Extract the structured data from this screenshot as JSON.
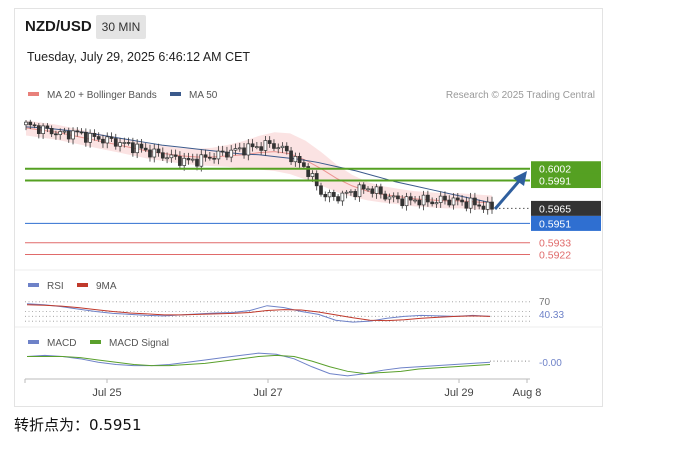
{
  "header": {
    "pair": "NZD/USD",
    "timeframe": "30 MIN",
    "datetime": "Tuesday, July 29, 2025 6:46:12 AM CET"
  },
  "legend_main": {
    "ma20": "MA 20 + Bollinger Bands",
    "ma50": "MA 50",
    "credit": "Research © 2025 Trading Central"
  },
  "legend_rsi": {
    "rsi": "RSI",
    "ma9": "9MA"
  },
  "legend_macd": {
    "macd": "MACD",
    "signal": "MACD Signal"
  },
  "colors": {
    "ma20": "#e8807a",
    "ma50": "#3b5a8c",
    "band_fill": "#fbe0e0",
    "green_level": "#55a022",
    "blue_level": "#2f6fd1",
    "red_level": "#e06a6a",
    "current": "#333333",
    "rsi": "#6e82c8",
    "rsi_ma": "#c0392b",
    "macd": "#6e82c8",
    "macd_signal": "#5aa02c",
    "arrow": "#2f5f9e"
  },
  "footer_note": "转折点为：0.5951",
  "chart_data": [
    {
      "type": "candlestick",
      "title": "NZD/USD 30 MIN",
      "x": [
        "Jul 25",
        "Jul 27",
        "Jul 29",
        "Aug 8"
      ],
      "price_levels": [
        {
          "value": 0.6002,
          "label": "0.6002",
          "color": "#55a022",
          "kind": "resistance"
        },
        {
          "value": 0.5991,
          "label": "0.5991",
          "color": "#55a022",
          "kind": "resistance"
        },
        {
          "value": 0.5965,
          "label": "0.5965",
          "color": "#333333",
          "kind": "current"
        },
        {
          "value": 0.5951,
          "label": "0.5951",
          "color": "#2f6fd1",
          "kind": "pivot"
        },
        {
          "value": 0.5933,
          "label": "0.5933",
          "color": "#e06a6a",
          "kind": "support"
        },
        {
          "value": 0.5922,
          "label": "0.5922",
          "color": "#e06a6a",
          "kind": "support"
        }
      ],
      "ylim": [
        0.5915,
        0.6054
      ],
      "close_series": [
        0.6043,
        0.604,
        0.6037,
        0.6034,
        0.6036,
        0.6032,
        0.603,
        0.6028,
        0.6025,
        0.6022,
        0.6018,
        0.6015,
        0.6012,
        0.6009,
        0.601,
        0.6013,
        0.6016,
        0.6019,
        0.6021,
        0.6023,
        0.6025,
        0.602,
        0.601,
        0.6,
        0.598,
        0.5975,
        0.5978,
        0.5982,
        0.5984,
        0.5978,
        0.5974,
        0.5972,
        0.5973,
        0.5971,
        0.5973,
        0.5972,
        0.597,
        0.5968,
        0.5965
      ],
      "ma20": [
        0.604,
        0.6038,
        0.6036,
        0.6033,
        0.603,
        0.6027,
        0.6024,
        0.6021,
        0.6018,
        0.6016,
        0.6014,
        0.6013,
        0.6013,
        0.6014,
        0.6015,
        0.6017,
        0.6018,
        0.6016,
        0.601,
        0.6002,
        0.5993,
        0.5986,
        0.5981,
        0.5978,
        0.5976,
        0.5974,
        0.5973,
        0.5972,
        0.5972,
        0.5971,
        0.597
      ],
      "ma50": [
        0.6041,
        0.604,
        0.6038,
        0.6036,
        0.6033,
        0.603,
        0.6027,
        0.6024,
        0.6022,
        0.602,
        0.6018,
        0.6016,
        0.6015,
        0.6013,
        0.6011,
        0.6008,
        0.6004,
        0.6,
        0.5995,
        0.599,
        0.5986,
        0.5982,
        0.5978,
        0.5974,
        0.597
      ],
      "forecast_arrow": {
        "from": 0.5965,
        "to": 0.5997
      }
    },
    {
      "type": "line",
      "title": "RSI",
      "levels": [
        70,
        30
      ],
      "current_label": "40.33",
      "top_label": "70",
      "series": [
        {
          "name": "RSI",
          "values": [
            66,
            64,
            60,
            55,
            50,
            46,
            44,
            42,
            41,
            43,
            45,
            47,
            48,
            52,
            62,
            58,
            50,
            44,
            32,
            28,
            30,
            36,
            40,
            42,
            41,
            40,
            42,
            40
          ]
        },
        {
          "name": "9MA",
          "values": [
            64,
            63,
            61,
            58,
            54,
            50,
            47,
            45,
            43,
            43,
            44,
            45,
            46,
            48,
            52,
            54,
            53,
            49,
            43,
            37,
            32,
            31,
            33,
            36,
            38,
            40,
            41,
            40
          ]
        }
      ]
    },
    {
      "type": "line",
      "title": "MACD",
      "current_label": "-0.00",
      "series": [
        {
          "name": "MACD",
          "values": [
            0.0004,
            0.0005,
            0.0004,
            0.0002,
            -0.0001,
            -0.0003,
            -0.0004,
            -0.0004,
            -0.0003,
            -0.0001,
            0.0001,
            0.0003,
            0.0005,
            0.0007,
            0.0006,
            0.0002,
            -0.0005,
            -0.0011,
            -0.0013,
            -0.0011,
            -0.0008,
            -0.0006,
            -0.0005,
            -0.0004,
            -0.0003,
            -0.0002,
            -0.0001
          ]
        },
        {
          "name": "MACD Signal",
          "values": [
            0.0004,
            0.0004,
            0.0004,
            0.0003,
            0.0001,
            -0.0001,
            -0.0003,
            -0.0004,
            -0.0004,
            -0.0003,
            -0.0002,
            0.0,
            0.0002,
            0.0004,
            0.0005,
            0.0004,
            0.0,
            -0.0005,
            -0.0009,
            -0.0011,
            -0.001,
            -0.0009,
            -0.0007,
            -0.0006,
            -0.0005,
            -0.0004,
            -0.0003
          ]
        }
      ]
    }
  ]
}
